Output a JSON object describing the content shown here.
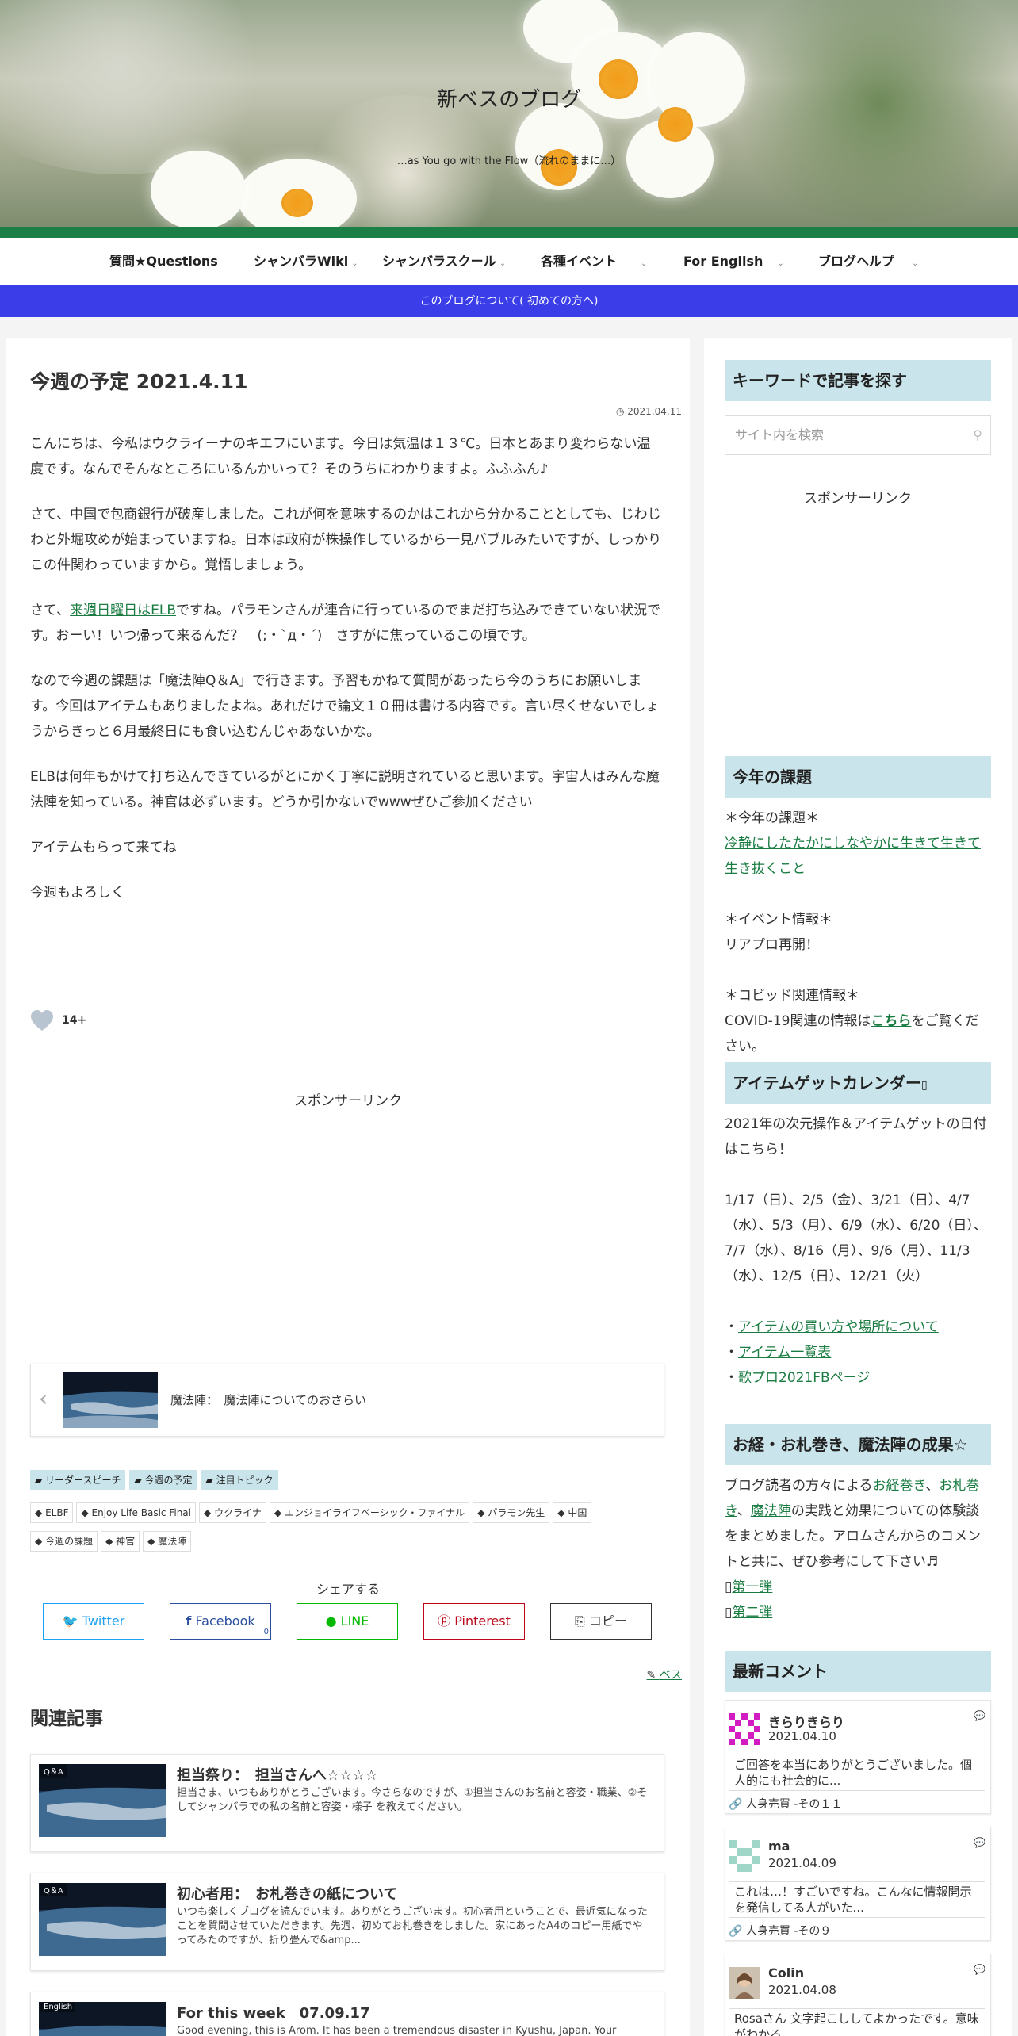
{
  "site": {
    "title": "新ベスのブログ",
    "description": "…as You go with the Flow（流れのままに…）"
  },
  "nav": [
    {
      "label": "質問★Questions"
    },
    {
      "label": "シャンバラWiki"
    },
    {
      "label": "シャンバラスクール"
    },
    {
      "label": "各種イベント"
    },
    {
      "label": "For English"
    },
    {
      "label": "ブログヘルプ"
    }
  ],
  "notice": " このブログについて( 初めての方へ)  ",
  "post": {
    "title": "今週の予定 2021.4.11",
    "date": "2021.04.11",
    "p1": "こんにちは、今私はウクライーナのキエフにいます。今日は気温は１３℃。日本とあまり変わらない温度です。なんでそんなところにいるんかいって？そのうちにわかりますよ。ふふふん♪",
    "p2": "さて、中国で包商銀行が破産しました。これが何を意味するのかはこれから分かることとしても、じわじわと外堀攻めが始まっていますね。日本は政府が株操作しているから一見バブルみたいですが、しっかりこの件関わっていますから。覚悟しましょう。",
    "p3_pre": "さて、",
    "p3_link": "来週日曜日はELB",
    "p3_post": "ですね。パラモンさんが連合に行っているのでまだ打ち込みできていない状況です。おーい！いつ帰って来るんだ？　(;・`д・´)　さすがに焦っているこの頃です。",
    "p4": "なので今週の課題は「魔法陣Q＆A」で行きます。予習もかねて質問があったら今のうちにお願いします。今回はアイテムもありましたよね。あれだけで論文１０冊は書ける内容です。言い尽くせないでしょうからきっと６月最終日にも食い込むんじゃあないかな。",
    "p5": "ELBは何年もかけて打ち込んできているがとにかく丁寧に説明されていると思います。宇宙人はみんな魔法陣を知っている。神官は必ずいます。どうか引かないでwwwぜひご参加ください",
    "p6": "アイテムもらって来てね",
    "p7": "今週もよろしく",
    "likes": "14+",
    "sponsor": "スポンサーリンク",
    "prev": "魔法陣：　魔法陣についてのおさらい",
    "categories": [
      "リーダースピーチ",
      "今週の予定",
      "注目トピック"
    ],
    "tags": [
      "ELBF",
      "Enjoy Life Basic Final",
      "ウクライナ",
      "エンジョイライフベーシック・ファイナル",
      "パラモン先生",
      "中国",
      "今週の課題",
      "神官",
      "魔法陣"
    ],
    "share_label": "シェアする",
    "share": [
      {
        "label": "Twitter",
        "color": "#1da1f2"
      },
      {
        "label": "Facebook",
        "color": "#2b4f9e"
      },
      {
        "label": "LINE",
        "color": "#00b900"
      },
      {
        "label": "Pinterest",
        "color": "#bd081c"
      },
      {
        "label": "コピー",
        "color": "#333333"
      }
    ],
    "facebook_count": "0",
    "author": "ベス"
  },
  "related": {
    "heading": "関連記事",
    "items": [
      {
        "label": "Q＆A",
        "title": "担当祭り：　担当さんへ☆☆☆☆",
        "excerpt": "担当さま、いつもありがとうございます。今さらなのですが、①担当さんのお名前と容姿・職業、②そしてシャンバラでの私の名前と容姿・様子 を教えてください。"
      },
      {
        "label": "Q＆A",
        "title": "初心者用：　お札巻きの紙について",
        "excerpt": "いつも楽しくブログを読んでいます。ありがとうございます。初心者用ということで、最近気になったことを質問させていただきます。先週、初めてお札巻きをしました。家にあったA4のコピー用紙でやってみたのですが、折り畳んで&amp..."
      },
      {
        "label": "English",
        "title": "For this week　07.09.17",
        "excerpt": "Good evening, this is Arom. It has been a tremendous disaster in Kyushu, Japan. Your"
      }
    ]
  },
  "sidebar": {
    "search_heading": "キーワードで記事を探す",
    "search_placeholder": "サイト内を検索",
    "sponsor": "スポンサーリンク",
    "kadai_heading": "今年の課題",
    "kadai_label": "＊今年の課題＊",
    "kadai_link": "冷静にしたたかにしなやかに生きて生きて生き抜くこと",
    "event_label": "＊イベント情報＊",
    "event_text": "リアプロ再開！",
    "covid_label": "＊コビッド関連情報＊",
    "covid_pre": "COVID-19関連の情報は",
    "covid_link": "こちら",
    "covid_post": "をご覧ください。",
    "calendar_heading": "アイテムゲットカレンダー",
    "calendar_intro": "2021年の次元操作＆アイテムゲットの日付はこちら！",
    "calendar_dates": "1/17（日）、2/5（金）、3/21（日）、4/7（水）、5/3（月）、6/9（水）、6/20（日）、7/7（水）、8/16（月）、9/6（月）、11/3（水）、12/5（日）、12/21（火）",
    "calendar_links": [
      "アイテムの買い方や場所について",
      "アイテム一覧表",
      "歌プロ2021FBページ"
    ],
    "okyo_heading": "お経・お札巻き、魔法陣の成果☆",
    "okyo_pre": "ブログ読者の方々による",
    "okyo_link1": "お経巻き",
    "okyo_sep": "、",
    "okyo_link2": "お札巻き",
    "okyo_link3": "魔法陣",
    "okyo_post": "の実践と効果についての体験談をまとめました。アロムさんからのコメントと共に、ぜひ参考にして下さい♬",
    "okyo_links": [
      "第一弾",
      "第二弾"
    ],
    "comments_heading": "最新コメント",
    "comments": [
      {
        "name": "きらりきらり",
        "date": "2021.04.10",
        "text": "ご回答を本当にありがとうございました。個人的にも社会的に...",
        "source": "人身売買 -その１１"
      },
      {
        "name": "ma",
        "date": "2021.04.09",
        "text": "これは…！すごいですね。こんなに情報開示を発信してる人がいた...",
        "source": "人身売買 -その９"
      },
      {
        "name": "Colin",
        "date": "2021.04.08",
        "text": "Rosaさん 文字起こししてよかったです。意味がわかる",
        "source": ""
      }
    ]
  }
}
